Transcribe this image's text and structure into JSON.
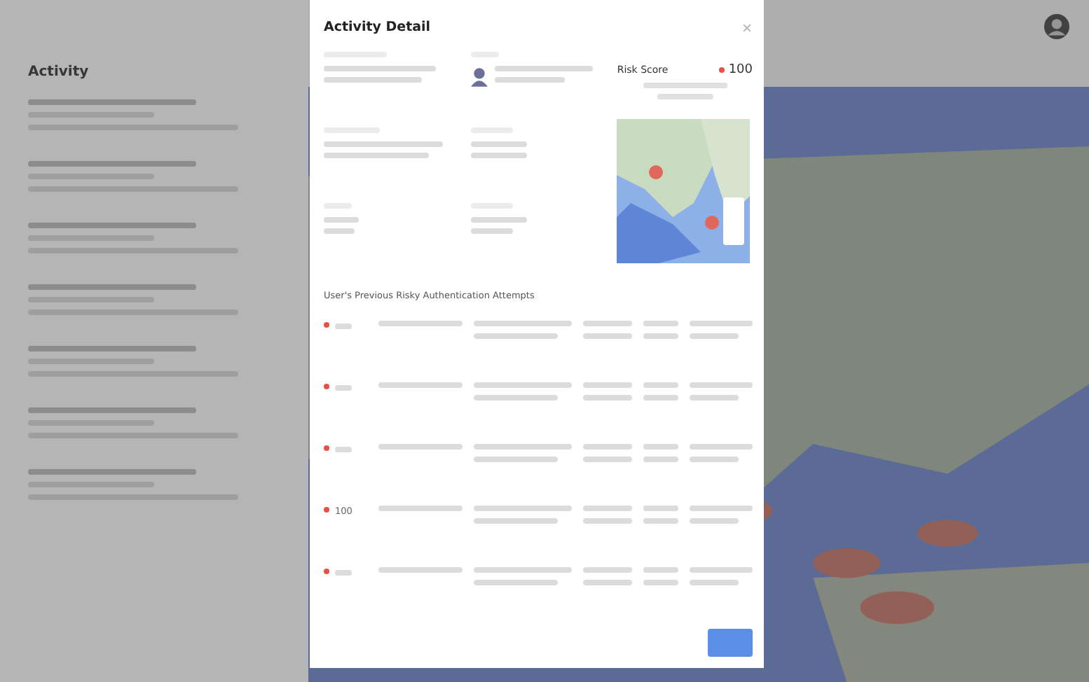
{
  "background": {
    "sidebar": {
      "title": "Activity"
    }
  },
  "dialog": {
    "title": "Activity Detail",
    "risk": {
      "label": "Risk Score",
      "score": "100"
    },
    "attempts_title": "User's Previous Risky Authentication Attempts",
    "attempts": [
      {
        "flagged": true
      },
      {
        "flagged": true
      },
      {
        "flagged": true
      },
      {
        "flagged": true,
        "score": "100"
      },
      {
        "flagged": true
      }
    ]
  }
}
